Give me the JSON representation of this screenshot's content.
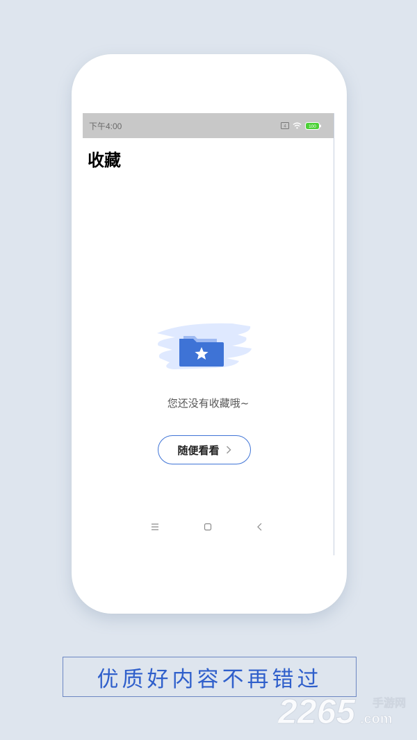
{
  "status_bar": {
    "time": "下午4:00",
    "battery": "100",
    "icons": [
      "sim-icon",
      "wifi-icon",
      "battery-icon"
    ]
  },
  "page": {
    "title": "收藏"
  },
  "empty_state": {
    "icon": "folder-star-icon",
    "message": "您还没有收藏哦~",
    "button_label": "随便看看"
  },
  "nav_bar": {
    "icons": [
      "menu-icon",
      "home-icon",
      "back-icon"
    ]
  },
  "caption": {
    "text": "优质好内容不再错过"
  },
  "watermark": {
    "brand": "2265",
    "suffix": ".com",
    "label": "手游网"
  },
  "colors": {
    "background": "#dee5ee",
    "accent_blue": "#3e73d6",
    "caption_blue": "#2f5fcb",
    "battery_green": "#4cd137",
    "status_bar_gray": "#c8c8c8"
  }
}
